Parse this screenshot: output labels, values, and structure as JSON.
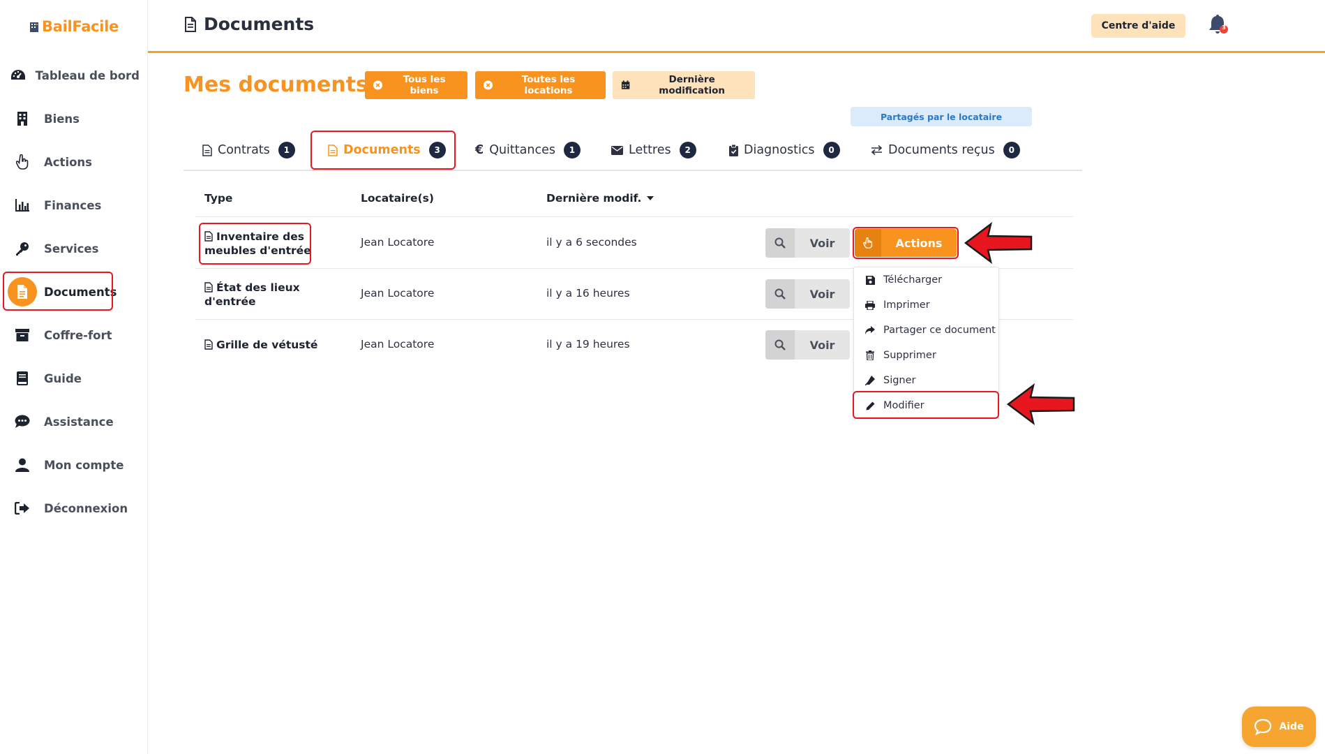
{
  "app": {
    "name": "BailFacile"
  },
  "sidebar": {
    "items": [
      {
        "label": "Tableau de bord",
        "icon": "dashboard-icon"
      },
      {
        "label": "Biens",
        "icon": "building-icon"
      },
      {
        "label": "Actions",
        "icon": "hand-pointer-icon"
      },
      {
        "label": "Finances",
        "icon": "bar-chart-icon"
      },
      {
        "label": "Services",
        "icon": "key-icon"
      },
      {
        "label": "Documents",
        "icon": "file-icon",
        "active": true
      },
      {
        "label": "Coffre-fort",
        "icon": "archive-icon"
      },
      {
        "label": "Guide",
        "icon": "book-icon"
      },
      {
        "label": "Assistance",
        "icon": "chat-icon"
      },
      {
        "label": "Mon compte",
        "icon": "user-icon"
      },
      {
        "label": "Déconnexion",
        "icon": "logout-icon"
      }
    ]
  },
  "header": {
    "title": "Documents",
    "help_label": "Centre d'aide",
    "notifications_count": "3"
  },
  "page": {
    "title": "Mes documents",
    "filters": [
      {
        "label": "Tous les biens",
        "icon": "close-circle-icon"
      },
      {
        "label": "Toutes les locations",
        "icon": "close-circle-icon"
      },
      {
        "label": "Dernière modification",
        "icon": "calendar-icon"
      }
    ],
    "shared_label": "Partagés par le locataire"
  },
  "tabs": [
    {
      "label": "Contrats",
      "count": "1",
      "icon": "file-icon"
    },
    {
      "label": "Documents",
      "count": "3",
      "icon": "file-icon",
      "active": true
    },
    {
      "label": "Quittances",
      "count": "1",
      "icon": "euro-icon"
    },
    {
      "label": "Lettres",
      "count": "2",
      "icon": "envelope-icon"
    },
    {
      "label": "Diagnostics",
      "count": "0",
      "icon": "clipboard-check-icon"
    },
    {
      "label": "Documents reçus",
      "count": "0",
      "icon": "exchange-icon"
    }
  ],
  "table": {
    "headers": {
      "type": "Type",
      "tenant": "Locataire(s)",
      "modified": "Dernière modif."
    },
    "rows": [
      {
        "type_line1": "Inventaire des",
        "type_line2": "meubles d'entrée",
        "tenant": "Jean Locatore",
        "modified": "il y a 6 secondes"
      },
      {
        "type_line1": "État des lieux",
        "type_line2": "d'entrée",
        "tenant": "Jean Locatore",
        "modified": "il y a 16 heures"
      },
      {
        "type_line1": "Grille de vétusté",
        "type_line2": "",
        "tenant": "Jean Locatore",
        "modified": "il y a 19 heures"
      }
    ],
    "view_label": "Voir",
    "actions_label": "Actions"
  },
  "dropdown": {
    "items": [
      {
        "label": "Télécharger",
        "icon": "save-icon"
      },
      {
        "label": "Imprimer",
        "icon": "print-icon"
      },
      {
        "label": "Partager ce document",
        "icon": "share-icon"
      },
      {
        "label": "Supprimer",
        "icon": "trash-icon"
      },
      {
        "label": "Signer",
        "icon": "signature-icon"
      },
      {
        "label": "Modifier",
        "icon": "pencil-icon"
      }
    ]
  },
  "aide": {
    "label": "Aide"
  },
  "colors": {
    "brand": "#f7931e",
    "highlight": "#e8171f",
    "badge": "#1e2840"
  }
}
